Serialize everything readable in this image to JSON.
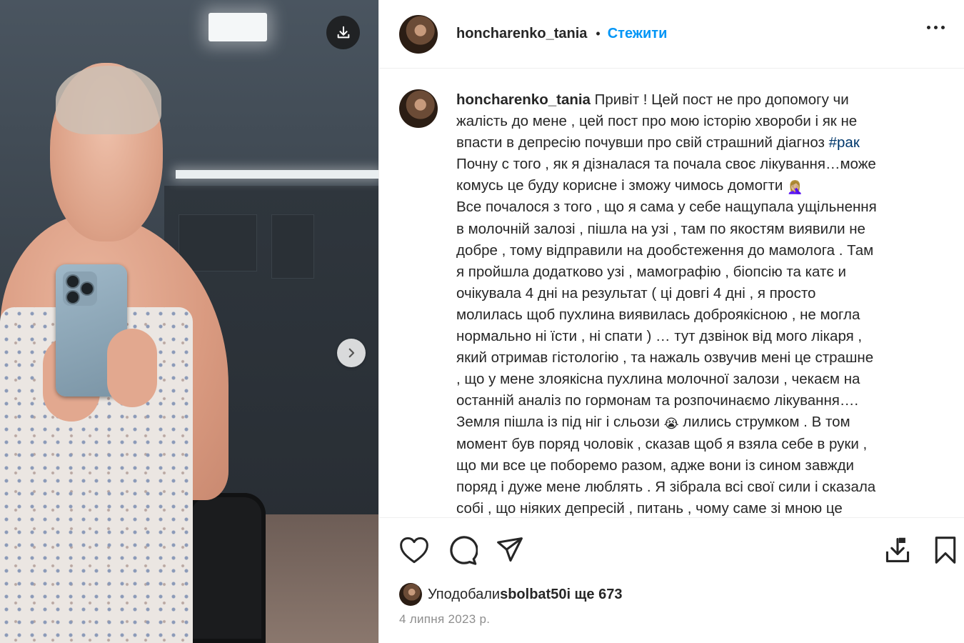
{
  "post": {
    "username": "honcharenko_tania",
    "separator": "•",
    "follow_label": "Стежити",
    "more_label": "More options"
  },
  "caption": {
    "username": "honcharenko_tania",
    "lines": [
      "Привіт ! Цей пост не про допомогу чи",
      "жалість до мене , цей пост про мою історію хвороби і як не",
      "впасти в депресію почувши про свій страшний діагноз ",
      "Почну с того , як я дізналася та почала своє лікування…може",
      "комусь це буду корисне і зможу чимось домогти ",
      "Все почалося з того , що я сама у себе нащупала ущільнення",
      "в молочній залозі , пішла на узі , там по якостям виявили не",
      "добре , тому відправили на дообстеження до мамолога . Там",
      "я пройшла додатково узі , мамографію , біопсію та катє и",
      "очікувала 4 дні на результат ( ці довгі 4 дні , я просто",
      "молилась щоб пухлина виявилась доброякісною , не могла",
      "нормально ні їсти , ні спати ) … тут дзвінок від мого лікаря ,",
      "який отримав гістологію , та нажаль озвучив мені це страшне",
      ", що у мене злоякісна пухлина молочної залози , чекаєм на",
      "останній аналіз по гормонам та розпочинаємо лікування….",
      "Земля пішла із під ніг і сльози ",
      "момент був поряд чоловік , сказав щоб я взяла себе в руки ,",
      "що ми все це поборемо разом, адже вони із сином завжди",
      "поряд і дуже мене люблять . Я зібрала всі свої сили і сказала",
      "собі , що ніяких депресій , питань , чому саме зі мною це"
    ],
    "hashtag": "#рак",
    "line16_tail": " лились струмком . В том",
    "emoji_facepalm": "🤦🏼‍♀️",
    "emoji_cry": "😭"
  },
  "likes": {
    "prefix": "Уподобали ",
    "user": "sbolbat50",
    "suffix": " і ще 673"
  },
  "date": "4 липня 2023 р.",
  "icons": {
    "download": "download-icon",
    "next": "chevron-right-icon",
    "like": "heart-icon",
    "comment": "comment-icon",
    "share": "send-icon",
    "save_to_device": "download-icon",
    "bookmark": "bookmark-icon"
  },
  "colors": {
    "accent": "#0095f6",
    "hashtag": "#00376b",
    "text": "#262626",
    "muted": "#8e8e8e"
  }
}
